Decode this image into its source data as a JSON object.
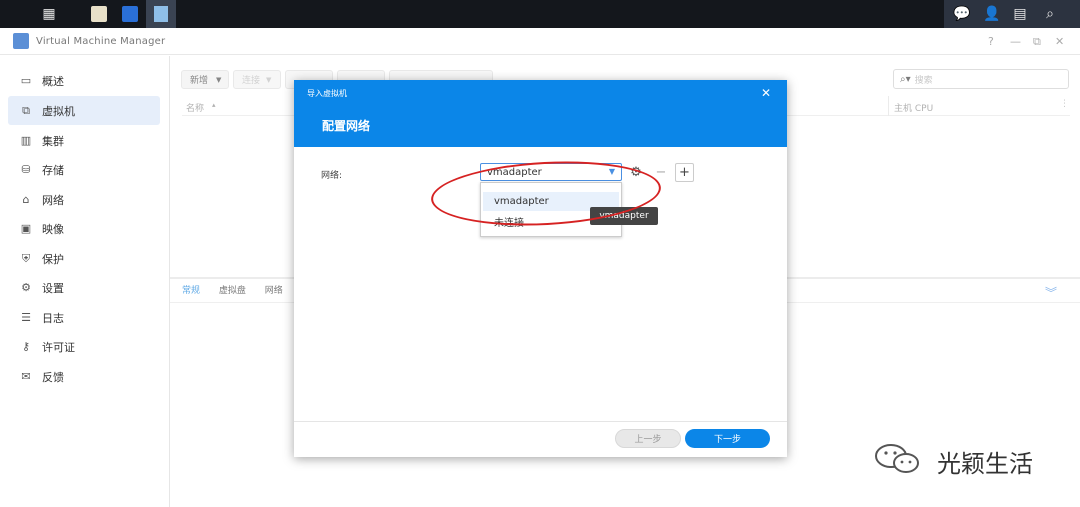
{
  "taskbar": {
    "icons": [
      "grid-icon",
      "app-icon-1",
      "app-icon-2",
      "vmm-icon"
    ],
    "right_icons": [
      "chat-icon",
      "user-icon",
      "widget-icon",
      "search-icon"
    ]
  },
  "window": {
    "title": "Virtual Machine Manager",
    "controls": [
      "?",
      "—",
      "⧉",
      "✕"
    ]
  },
  "sidebar": {
    "items": [
      {
        "label": "概述",
        "icon": "overview-icon"
      },
      {
        "label": "虚拟机",
        "icon": "vm-icon",
        "active": true
      },
      {
        "label": "集群",
        "icon": "cluster-icon"
      },
      {
        "label": "存储",
        "icon": "storage-icon"
      },
      {
        "label": "网络",
        "icon": "network-icon"
      },
      {
        "label": "映像",
        "icon": "image-icon"
      },
      {
        "label": "保护",
        "icon": "shield-icon"
      },
      {
        "label": "设置",
        "icon": "gear-icon"
      },
      {
        "label": "日志",
        "icon": "list-icon"
      },
      {
        "label": "许可证",
        "icon": "key-icon"
      },
      {
        "label": "反馈",
        "icon": "mail-icon"
      }
    ]
  },
  "toolbar": {
    "new_label": "新增",
    "connect_label": "连接"
  },
  "search": {
    "placeholder": "搜索"
  },
  "grid": {
    "col_name": "名称",
    "col_host_cpu": "主机 CPU"
  },
  "lower_tabs": [
    "常规",
    "虚拟盘",
    "网络"
  ],
  "modal": {
    "title": "导入虚拟机",
    "subtitle": "配置网络",
    "network_label": "网络:",
    "selected_value": "vmadapter",
    "options": [
      "vmadapter",
      "未连接"
    ],
    "tooltip": "vmadapter",
    "prev_label": "上一步",
    "next_label": "下一步"
  },
  "watermark": {
    "text": "光颖生活"
  },
  "colors": {
    "accent": "#0b86e8",
    "annotation": "#d62222"
  }
}
